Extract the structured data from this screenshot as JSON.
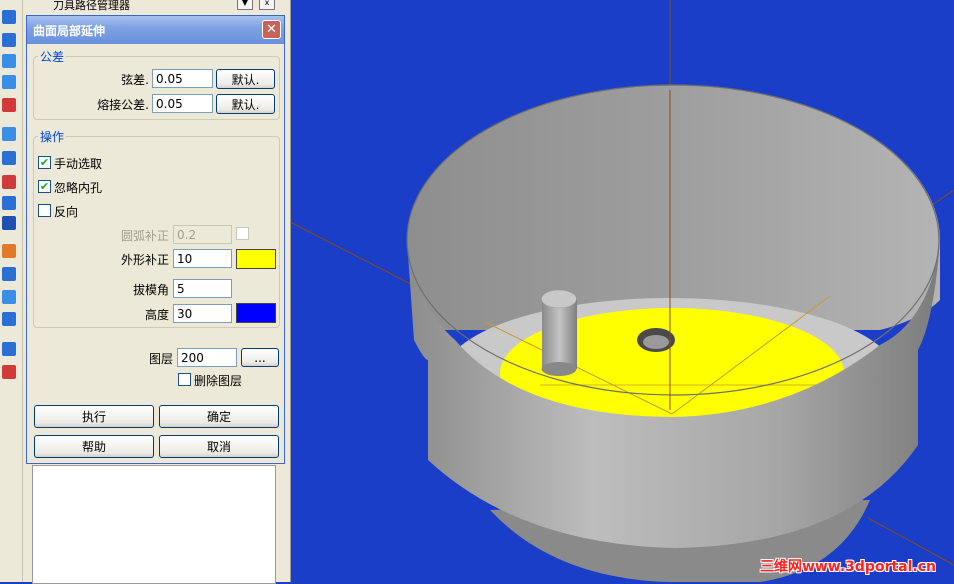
{
  "background_panel": {
    "title": "刀具路径管理器"
  },
  "dialog": {
    "title": "曲面局部延伸",
    "tolerance": {
      "legend": "公差",
      "chord": {
        "label": "弦差.",
        "value": "0.05",
        "default_label": "默认."
      },
      "weld": {
        "label": "熔接公差.",
        "value": "0.05",
        "default_label": "默认."
      }
    },
    "operation": {
      "legend": "操作",
      "manual_select": {
        "label": "手动选取",
        "checked": true
      },
      "ignore_holes": {
        "label": "忽略内孔",
        "checked": true
      },
      "reverse": {
        "label": "反向",
        "checked": false
      },
      "arc_comp": {
        "label": "圆弧补正",
        "value": "0.2",
        "disabled": true
      },
      "outline_comp": {
        "label": "外形补正",
        "value": "10",
        "color": "#ffff00"
      },
      "draft_angle": {
        "label": "拔模角",
        "value": "5"
      },
      "height": {
        "label": "高度",
        "value": "30",
        "color": "#0000ff"
      }
    },
    "layer": {
      "label": "图层",
      "value": "200",
      "browse_label": "...",
      "delete_label": "删除图层",
      "delete_checked": false
    },
    "buttons": {
      "execute": "执行",
      "ok": "确定",
      "help": "帮助",
      "cancel": "取消"
    }
  },
  "watermark": {
    "cn": "三维网",
    "url": "www.3dportal.cn"
  },
  "colors": {
    "viewport_bg": "#1a3ec8",
    "surface_fill": "#ffff00",
    "model_gray": "#a8a8a8"
  }
}
